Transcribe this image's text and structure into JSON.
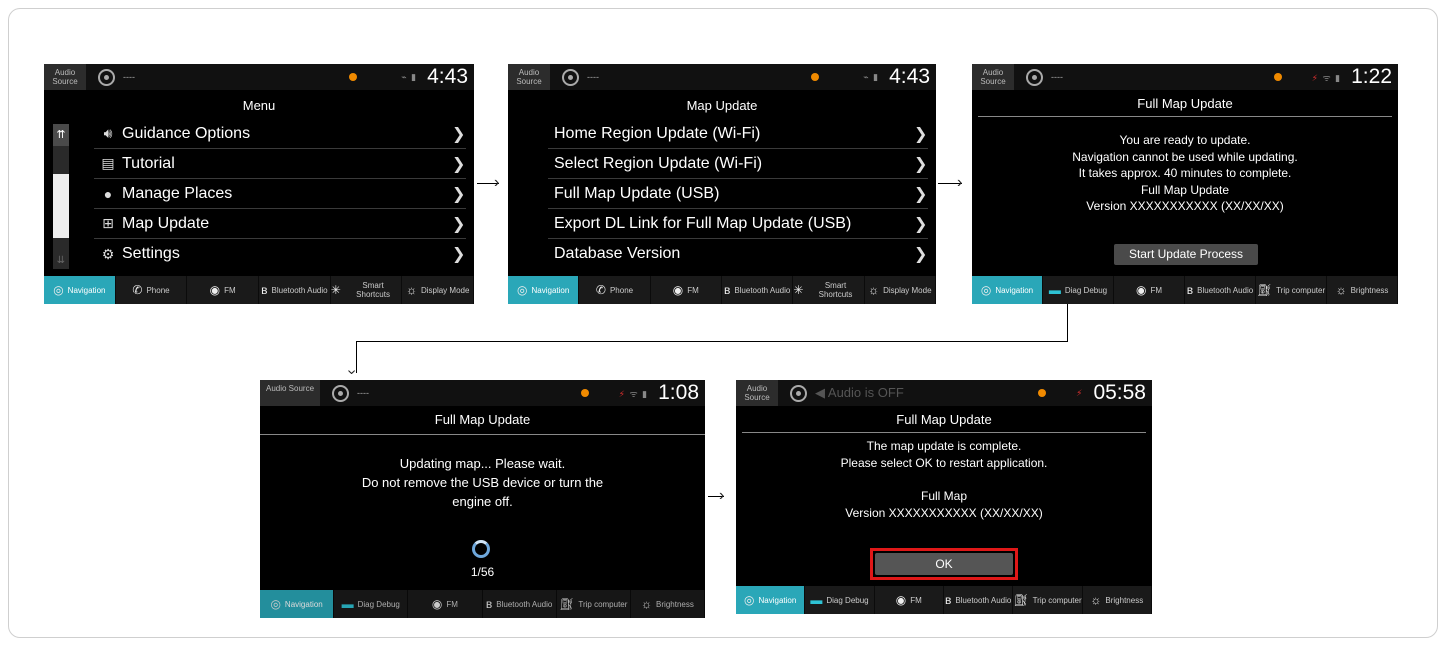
{
  "screens": {
    "menu": {
      "status": {
        "audio_source": "Audio Source",
        "station": "----",
        "time": "4:43"
      },
      "title": "Menu",
      "items": [
        {
          "label": "Guidance Options",
          "icon": "speaker-icon"
        },
        {
          "label": "Tutorial",
          "icon": "book-icon"
        },
        {
          "label": "Manage Places",
          "icon": "person-icon"
        },
        {
          "label": "Map Update",
          "icon": "map-update-icon"
        },
        {
          "label": "Settings",
          "icon": "gear-icon"
        }
      ]
    },
    "map_update": {
      "status": {
        "audio_source": "Audio Source",
        "station": "----",
        "time": "4:43"
      },
      "title": "Map Update",
      "items": [
        {
          "label": "Home Region Update (Wi-Fi)"
        },
        {
          "label": "Select Region Update (Wi-Fi)"
        },
        {
          "label": "Full Map Update (USB)"
        },
        {
          "label": "Export DL Link for Full Map Update (USB)"
        },
        {
          "label": "Database Version"
        }
      ]
    },
    "full_update_ready": {
      "status": {
        "audio_source": "Audio Source",
        "station": "----",
        "time": "1:22"
      },
      "title": "Full Map Update",
      "lines": [
        "You are ready to update.",
        "Navigation cannot be used while updating.",
        "It takes approx. 40 minutes to complete.",
        "Full Map Update",
        "Version XXXXXXXXXXX (XX/XX/XX)"
      ],
      "button": "Start Update Process"
    },
    "updating": {
      "status": {
        "audio_source": "Audio Source",
        "station": "----",
        "time": "1:08"
      },
      "title": "Full Map Update",
      "lines": [
        "Updating map... Please wait.",
        "Do not remove the USB device or turn the",
        "engine off."
      ],
      "progress": "1/56"
    },
    "complete": {
      "status": {
        "audio_source": "Audio Source",
        "audio_state": "Audio is OFF",
        "time": "05:58"
      },
      "title": "Full Map Update",
      "lines": [
        "The map update is complete.",
        "Please select OK to restart application.",
        "Full Map",
        "Version XXXXXXXXXXX (XX/XX/XX)"
      ],
      "button": "OK"
    }
  },
  "bottom_bars": {
    "a": [
      {
        "label": "Navigation",
        "icon": "navigation-icon",
        "active": true
      },
      {
        "label": "Phone",
        "icon": "phone-icon"
      },
      {
        "label": "FM",
        "icon": "radio-icon"
      },
      {
        "label": "Bluetooth Audio",
        "icon": "bluetooth-icon"
      },
      {
        "label": "Smart Shortcuts",
        "icon": "shortcuts-icon"
      },
      {
        "label": "Display Mode",
        "icon": "display-icon"
      }
    ],
    "b": [
      {
        "label": "Navigation",
        "icon": "navigation-icon",
        "active": true
      },
      {
        "label": "Diag Debug",
        "icon": "diag-icon"
      },
      {
        "label": "FM",
        "icon": "radio-icon"
      },
      {
        "label": "Bluetooth Audio",
        "icon": "bluetooth-icon"
      },
      {
        "label": "Trip computer",
        "icon": "fuel-icon"
      },
      {
        "label": "Brightness",
        "icon": "brightness-icon"
      }
    ]
  },
  "colors": {
    "accent_teal": "#2aa7b8",
    "ok_highlight": "#e01818",
    "status_dot": "#f08a00"
  }
}
